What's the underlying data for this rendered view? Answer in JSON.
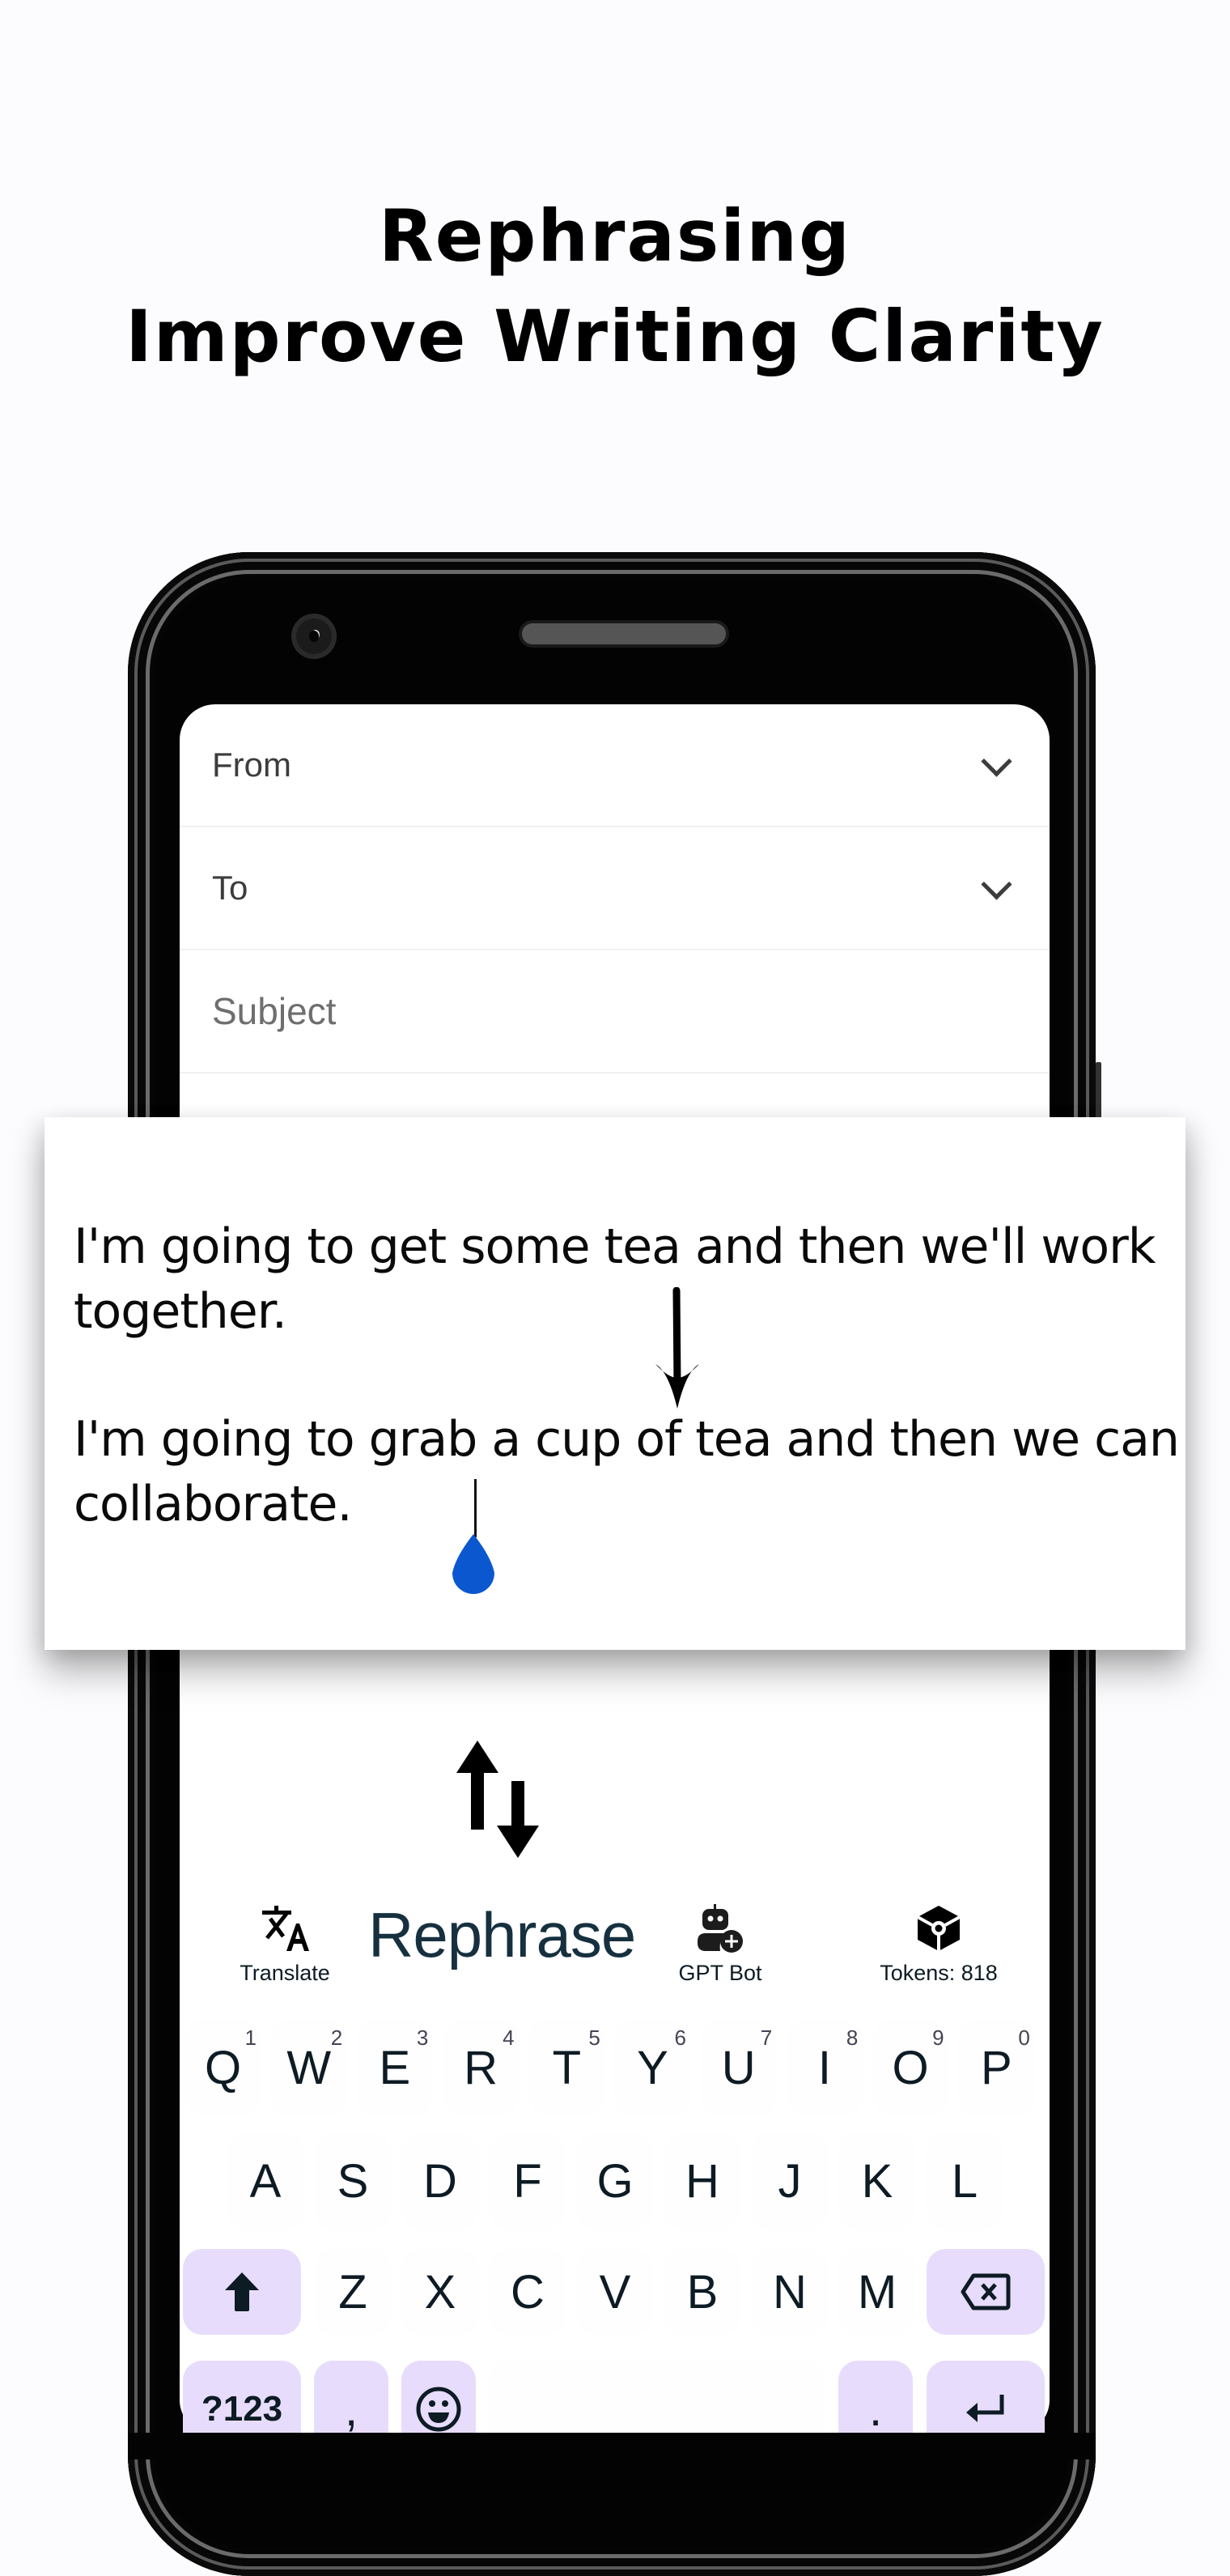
{
  "headline": {
    "line1": "Rephrasing",
    "line2": "Improve Writing Clarity"
  },
  "email": {
    "from_label": "From",
    "to_label": "To",
    "subject_placeholder": "Subject"
  },
  "card": {
    "original_text": "I'm going to get some tea and then we'll work together.",
    "rephrased_text": "I'm going to grab a cup of tea and then we can collaborate."
  },
  "toolbar": {
    "translate_label": "Translate",
    "rephrase_label": "Rephrase",
    "gpt_bot_label": "GPT Bot",
    "tokens_label": "Tokens: 818"
  },
  "keyboard": {
    "row1": [
      {
        "key": "Q",
        "hint": "1"
      },
      {
        "key": "W",
        "hint": "2"
      },
      {
        "key": "E",
        "hint": "3"
      },
      {
        "key": "R",
        "hint": "4"
      },
      {
        "key": "T",
        "hint": "5"
      },
      {
        "key": "Y",
        "hint": "6"
      },
      {
        "key": "U",
        "hint": "7"
      },
      {
        "key": "I",
        "hint": "8"
      },
      {
        "key": "O",
        "hint": "9"
      },
      {
        "key": "P",
        "hint": "0"
      }
    ],
    "row2": [
      "A",
      "S",
      "D",
      "F",
      "G",
      "H",
      "J",
      "K",
      "L"
    ],
    "row3": [
      "Z",
      "X",
      "C",
      "V",
      "B",
      "N",
      "M"
    ],
    "symbols_label": "?123",
    "comma_label": ",",
    "period_label": "."
  },
  "colors": {
    "fn_key": "#e8dcfc",
    "handle": "#0b57d0",
    "text_dark": "#0d1b24"
  }
}
